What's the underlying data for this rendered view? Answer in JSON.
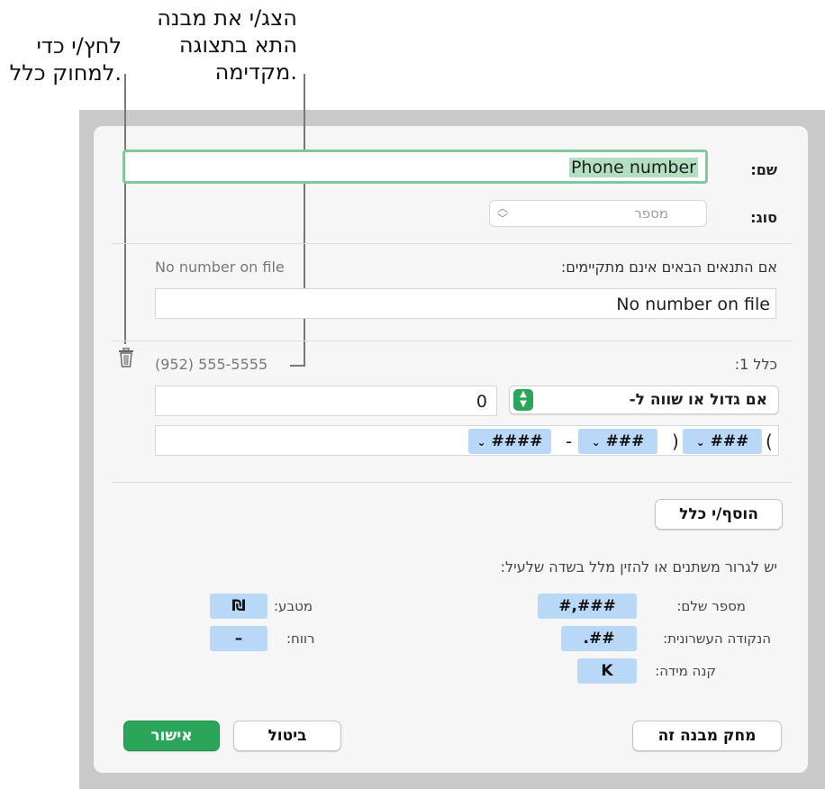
{
  "callouts": {
    "delete_rule": "לחץ/י כדי\nלמחוק כלל.",
    "preview": "הצג/י את מבנה\nהתא בתצוגה\nמקדימה."
  },
  "name": {
    "label": "שם:",
    "value": "Phone number"
  },
  "type": {
    "label": "סוג:",
    "value": "מספר"
  },
  "no_match": {
    "label": "אם התנאים הבאים אינם מתקיימים:",
    "preview": "No number on file",
    "value": "No number on file"
  },
  "rule1": {
    "label": "כלל 1:",
    "preview": "(952) 555-5555",
    "condition": "אם גדול או שווה ל-",
    "value": "0",
    "tokens": [
      "###",
      "###",
      "####"
    ],
    "open_paren": "(",
    "close_paren": ")",
    "dash": "-",
    "delete_icon": "trash-icon"
  },
  "add_rule_label": "הוסף/י כלל",
  "hint": "יש לגרור משתנים או להזין מלל בשדה שלעיל:",
  "variables": {
    "whole_number": {
      "label": "מספר שלם:",
      "token": "#,###"
    },
    "decimal": {
      "label": "הנקודה העשרונית:",
      "token": ".##"
    },
    "scale": {
      "label": "קנה מידה:",
      "token": "K"
    },
    "currency": {
      "label": "מטבע:",
      "token": "₪"
    },
    "space": {
      "label": "רווח:",
      "token": "–"
    }
  },
  "buttons": {
    "delete_format": "מחק מבנה זה",
    "cancel": "ביטול",
    "ok": "אישור"
  },
  "colors": {
    "accent_green": "#2aa55a",
    "focus_ring": "#7fc99b",
    "token_blue": "#b9d7f7"
  }
}
